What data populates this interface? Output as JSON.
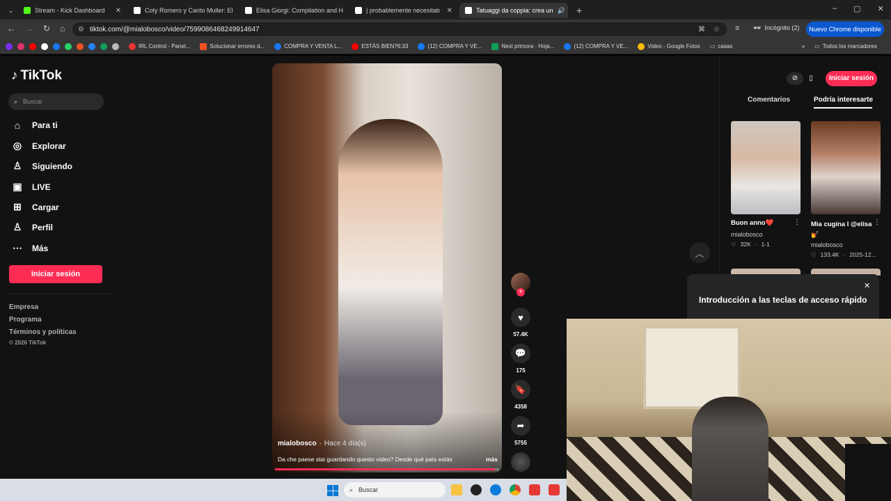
{
  "browser": {
    "tabs": [
      {
        "title": "Stream - Kick Dashboard",
        "color": "#53fc18"
      },
      {
        "title": "Coty Romero y Carito Muller: El",
        "color": "#fff"
      },
      {
        "title": "Elisa Giorgi: Compilation and H",
        "color": "#fff"
      },
      {
        "title": "| probablemente necesitab",
        "color": "#ff4f7a"
      },
      {
        "title": "Tatuaggi da coppia: crea un",
        "color": "#fff"
      }
    ],
    "url": "tiktok.com/@mialobosco/video/7599086468249914647",
    "incognito": "Incógnito (2)",
    "update": "Nuevo Chrome disponible",
    "bookmarks": [
      "IRL Control - Panel...",
      "Solucionar errores d...",
      "COMPRA Y VENTA L...",
      "ESTÁS BIEN?6:33",
      "(12) COMPRA Y VE...",
      "Next primora - Hoja...",
      "(12) COMPRA Y VE...",
      "Video - Google Fotos",
      "casas"
    ],
    "all_bookmarks": "Todos los marcadores"
  },
  "tiktok": {
    "logo": "TikTok",
    "search_placeholder": "Buscar",
    "nav": [
      {
        "label": "Para ti",
        "icon": "home-icon",
        "glyph": "⌂"
      },
      {
        "label": "Explorar",
        "icon": "compass-icon",
        "glyph": "◎"
      },
      {
        "label": "Siguiendo",
        "icon": "following-icon",
        "glyph": "♙"
      },
      {
        "label": "LIVE",
        "icon": "live-icon",
        "glyph": "▣"
      },
      {
        "label": "Cargar",
        "icon": "upload-icon",
        "glyph": "⊞"
      },
      {
        "label": "Perfil",
        "icon": "profile-icon",
        "glyph": "♙"
      },
      {
        "label": "Más",
        "icon": "more-icon",
        "glyph": "⋯"
      }
    ],
    "login": "Iniciar sesión",
    "footer": [
      "Empresa",
      "Programa",
      "Términos y políticas"
    ],
    "copyright": "© 2026 TikTok",
    "video": {
      "author": "mialobosco",
      "time": "Hace 4 día(s)",
      "caption": "Da che paese stai guardando questo video? Desde qué país estás",
      "more": "más",
      "progress": 0.98
    },
    "actions": {
      "likes": "57.4K",
      "comments": "175",
      "saves": "4358",
      "shares": "5755"
    },
    "right": {
      "login": "Iniciar sesión",
      "tabs": [
        "Comentarios",
        "Podría interesarte"
      ],
      "cards": [
        {
          "title": "Buon anno❤️",
          "author": "mialobosco",
          "likes": "32K",
          "date": "1-1"
        },
        {
          "title": "Mia cugina I @elisa💅",
          "author": "mialobosco",
          "likes": "133.4K",
          "date": "2025-12..."
        }
      ],
      "shortcut": "Introducción a las teclas de acceso rápido"
    }
  },
  "taskbar": {
    "search": "Buscar"
  }
}
